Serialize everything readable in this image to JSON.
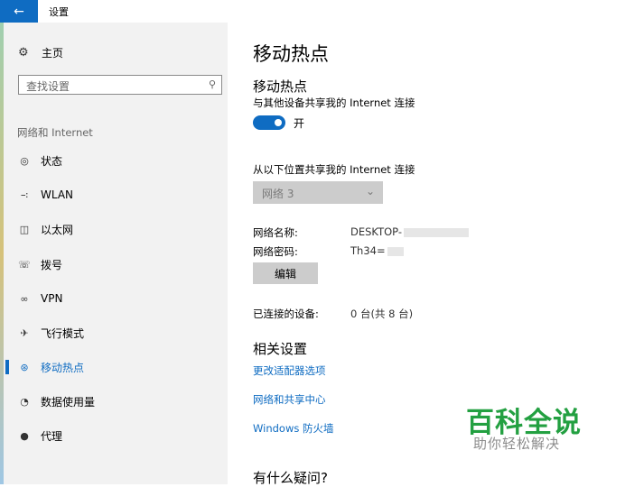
{
  "window": {
    "title": "设置"
  },
  "sidebar": {
    "home_label": "主页",
    "search_placeholder": "查找设置",
    "section_label": "网络和 Internet",
    "items": [
      {
        "label": "状态",
        "icon": "status-icon"
      },
      {
        "label": "WLAN",
        "icon": "wifi-icon"
      },
      {
        "label": "以太网",
        "icon": "ethernet-icon"
      },
      {
        "label": "拨号",
        "icon": "dialup-icon"
      },
      {
        "label": "VPN",
        "icon": "vpn-icon"
      },
      {
        "label": "飞行模式",
        "icon": "airplane-icon"
      },
      {
        "label": "移动热点",
        "icon": "hotspot-icon",
        "active": true
      },
      {
        "label": "数据使用量",
        "icon": "data-usage-icon"
      },
      {
        "label": "代理",
        "icon": "proxy-icon"
      }
    ]
  },
  "main": {
    "page_title": "移动热点",
    "section_title": "移动热点",
    "share_label": "与其他设备共享我的 Internet 连接",
    "toggle_state": "开",
    "from_label": "从以下位置共享我的 Internet 连接",
    "source_select": "网络 3",
    "network_name_label": "网络名称:",
    "network_name_value": "DESKTOP-",
    "network_password_label": "网络密码:",
    "network_password_value": "Th34=",
    "edit_button": "编辑",
    "connected_label": "已连接的设备:",
    "connected_value": "0 台(共 8 台)",
    "related_title": "相关设置",
    "links": [
      "更改适配器选项",
      "网络和共享中心",
      "Windows 防火墙"
    ],
    "question_title": "有什么疑问?"
  },
  "watermark": {
    "title": "百科全说",
    "subtitle": "助你轻松解决"
  },
  "colors": {
    "accent": "#0f6cc2",
    "watermark": "#23a041"
  }
}
